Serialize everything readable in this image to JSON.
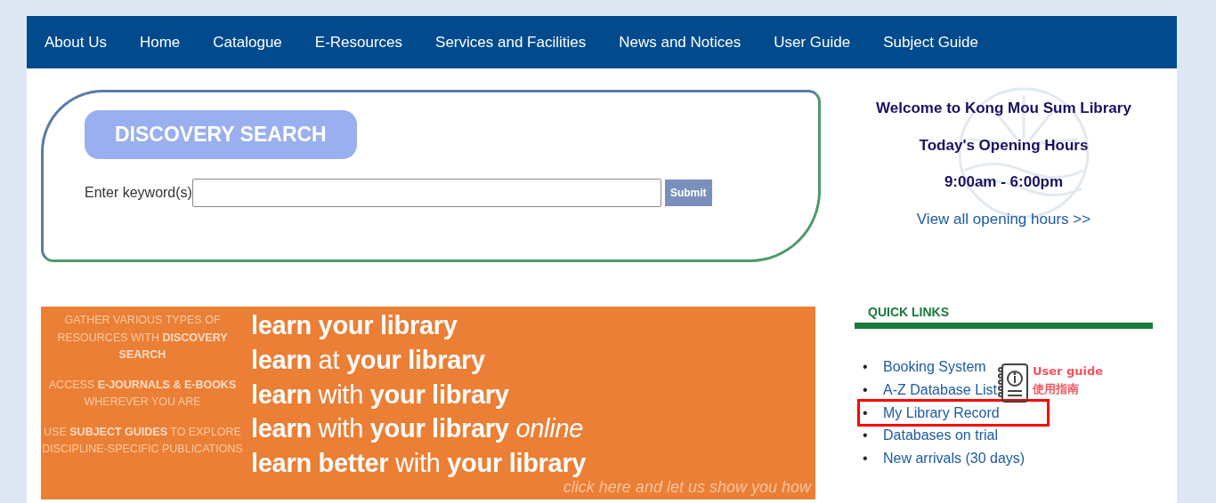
{
  "nav": {
    "items": [
      {
        "label": "About Us"
      },
      {
        "label": "Home"
      },
      {
        "label": "Catalogue"
      },
      {
        "label": "E-Resources"
      },
      {
        "label": "Services and Facilities"
      },
      {
        "label": "News and Notices"
      },
      {
        "label": "User Guide"
      },
      {
        "label": "Subject Guide"
      }
    ]
  },
  "search": {
    "title": "DISCOVERY SEARCH",
    "label": "Enter keyword(s)",
    "button": "Submit"
  },
  "banner": {
    "kind": "picture-text",
    "side_text": [
      "GATHER VARIOUS TYPES OF RESOURCES WITH **DISCOVERY SEARCH**",
      "ACCESS **E-JOURNALS & E-BOOKS** WHEREVER YOU ARE",
      "USE **SUBJECT GUIDES** TO EXPLORE DISCIPLINE-SPECIFIC PUBLICATIONS"
    ],
    "lines": [
      "**learn your library**",
      "**learn** at **your library**",
      "**learn** with **your library**",
      "**learn** with **your library** *online*",
      "**learn better** with **your library**"
    ],
    "caption": "click here and let us show you how"
  },
  "welcome": {
    "title": "Welcome to Kong Mou Sum Library",
    "hours_heading": "Today's Opening Hours",
    "hours": "9:00am - 6:00pm",
    "link": "View all opening hours >>"
  },
  "quick_links": {
    "heading": "QUICK LINKS",
    "bullet": "•",
    "guide_note": [
      "User guide",
      "使用指南"
    ],
    "items": [
      {
        "label": "Booking System",
        "highlighted": false
      },
      {
        "label": "A-Z Database List",
        "highlighted": false
      },
      {
        "label": "My Library Record",
        "highlighted": true
      },
      {
        "label": "Databases on trial",
        "highlighted": false
      },
      {
        "label": "New arrivals (30 days)",
        "highlighted": false
      }
    ]
  }
}
